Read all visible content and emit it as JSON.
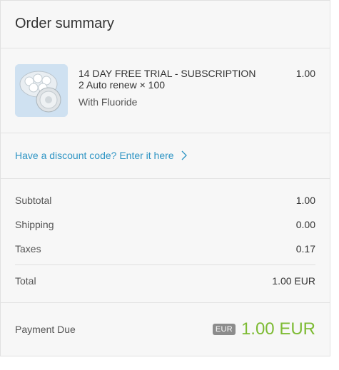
{
  "header": {
    "title": "Order summary"
  },
  "item": {
    "name": "14 DAY FREE TRIAL - SUBSCRIPTION 2 Auto renew × 100",
    "variant": "With Fluoride",
    "price": "1.00",
    "image_icon": "product-jar-icon"
  },
  "discount": {
    "label": "Have a discount code? Enter it here"
  },
  "totals": {
    "subtotal_label": "Subtotal",
    "subtotal_value": "1.00",
    "shipping_label": "Shipping",
    "shipping_value": "0.00",
    "taxes_label": "Taxes",
    "taxes_value": "0.17",
    "total_label": "Total",
    "total_value": "1.00 EUR"
  },
  "payment_due": {
    "label": "Payment Due",
    "currency_badge": "EUR",
    "amount": "1.00 EUR"
  },
  "colors": {
    "link": "#2f95c4",
    "accent_green": "#7dbb33",
    "badge_gray": "#8c8c8c",
    "panel_bg": "#f7f7f7"
  }
}
